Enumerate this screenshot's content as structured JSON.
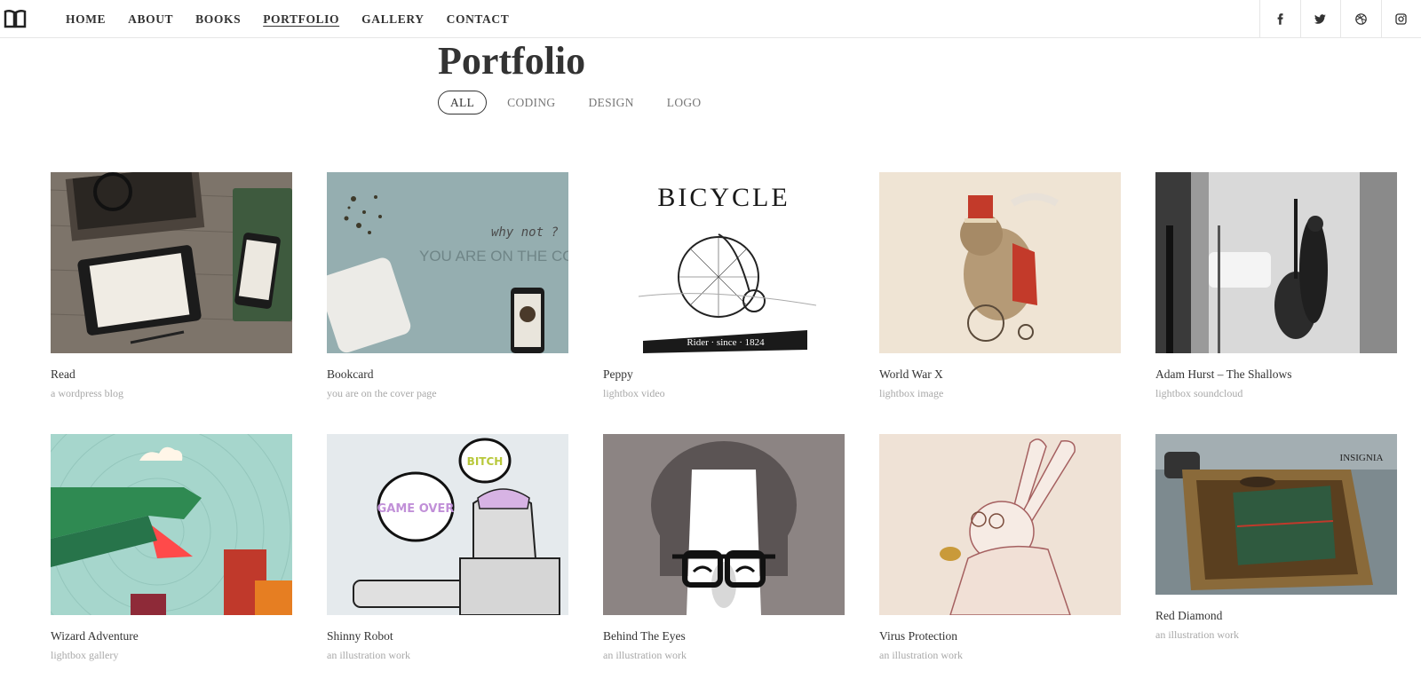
{
  "nav": {
    "logo_icon": "open-book-icon",
    "items": [
      {
        "label": "HOME",
        "active": false
      },
      {
        "label": "ABOUT",
        "active": false
      },
      {
        "label": "BOOKS",
        "active": false
      },
      {
        "label": "PORTFOLIO",
        "active": true
      },
      {
        "label": "GALLERY",
        "active": false
      },
      {
        "label": "CONTACT",
        "active": false
      }
    ],
    "social": [
      "facebook-icon",
      "twitter-icon",
      "dribbble-icon",
      "instagram-icon"
    ]
  },
  "page": {
    "title": "Portfolio",
    "filters": [
      {
        "label": "ALL",
        "active": true
      },
      {
        "label": "CODING",
        "active": false
      },
      {
        "label": "DESIGN",
        "active": false
      },
      {
        "label": "LOGO",
        "active": false
      }
    ]
  },
  "thumb_text": {
    "bookcard_line1": "why not ?",
    "bookcard_line2": "YOU ARE ON THE COV",
    "bicycle_title": "BICYCLE",
    "bicycle_banner": "Rider · since · 1824",
    "robot_bubble1": "GAME OVER",
    "robot_bubble2": "BITCH",
    "red_diamond_stamp": "INSIGNIA"
  },
  "portfolio": [
    {
      "title": "Read",
      "subtitle": "a wordpress blog"
    },
    {
      "title": "Bookcard",
      "subtitle": "you are on the cover page"
    },
    {
      "title": "Peppy",
      "subtitle": "lightbox video"
    },
    {
      "title": "World War X",
      "subtitle": "lightbox image"
    },
    {
      "title": "Adam Hurst – The Shallows",
      "subtitle": "lightbox soundcloud"
    },
    {
      "title": "Wizard Adventure",
      "subtitle": "lightbox gallery"
    },
    {
      "title": "Shinny Robot",
      "subtitle": "an illustration work"
    },
    {
      "title": "Behind The Eyes",
      "subtitle": "an illustration work"
    },
    {
      "title": "Virus Protection",
      "subtitle": "an illustration work"
    },
    {
      "title": "Red Diamond",
      "subtitle": "an illustration work"
    }
  ]
}
